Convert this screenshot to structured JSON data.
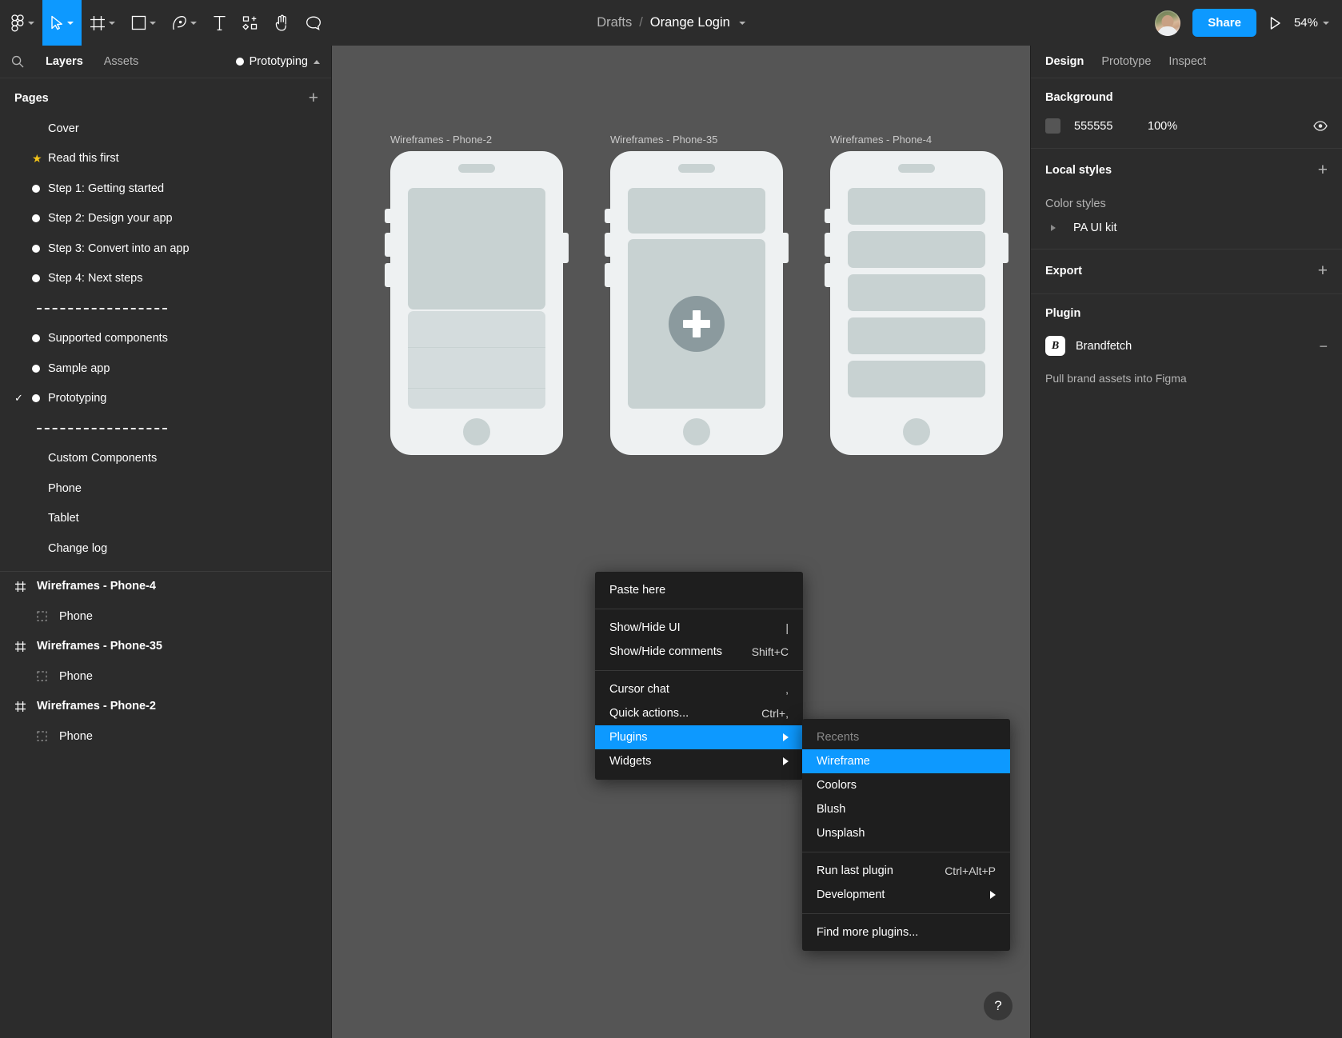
{
  "toolbar": {
    "menu_icon": "figma-logo-icon",
    "tools": [
      {
        "name": "figma-menu",
        "icon": "figma-logo-icon",
        "caret": true,
        "active": false
      },
      {
        "name": "move-tool",
        "icon": "cursor-icon",
        "caret": true,
        "active": true
      },
      {
        "name": "frame-tool",
        "icon": "frame-icon",
        "caret": true,
        "active": false
      },
      {
        "name": "shape-tool",
        "icon": "square-icon",
        "caret": true,
        "active": false
      },
      {
        "name": "pen-tool",
        "icon": "pen-icon",
        "caret": true,
        "active": false
      },
      {
        "name": "text-tool",
        "icon": "text-icon",
        "caret": false,
        "active": false
      },
      {
        "name": "resources-tool",
        "icon": "components-icon",
        "caret": false,
        "active": false
      },
      {
        "name": "hand-tool",
        "icon": "hand-icon",
        "caret": false,
        "active": false
      },
      {
        "name": "comment-tool",
        "icon": "comment-icon",
        "caret": false,
        "active": false
      }
    ],
    "breadcrumb": {
      "project": "Drafts",
      "separator": "/",
      "file": "Orange Login"
    },
    "share_label": "Share",
    "present_icon": "play-icon",
    "zoom_level": "54%",
    "avatar_name": "avatar"
  },
  "left_panel": {
    "search_icon": "search-icon",
    "tabs": [
      {
        "label": "Layers",
        "selected": true
      },
      {
        "label": "Assets",
        "selected": false
      }
    ],
    "prototyping_label": "Prototyping",
    "pages_header": "Pages",
    "add_page_label": "+",
    "pages": [
      {
        "label": "Cover",
        "glyph": "none",
        "checked": false
      },
      {
        "label": "Read this first",
        "glyph": "star",
        "checked": false
      },
      {
        "label": "Step 1: Getting started",
        "glyph": "dot",
        "checked": false
      },
      {
        "label": "Step 2: Design your app",
        "glyph": "dot",
        "checked": false
      },
      {
        "label": "Step 3: Convert into an app",
        "glyph": "dot",
        "checked": false
      },
      {
        "label": "Step 4: Next steps",
        "glyph": "dot",
        "checked": false
      },
      {
        "label": "",
        "glyph": "divider",
        "checked": false
      },
      {
        "label": "Supported components",
        "glyph": "dot",
        "checked": false
      },
      {
        "label": "Sample app",
        "glyph": "dot",
        "checked": false
      },
      {
        "label": "Prototyping",
        "glyph": "dot",
        "checked": true
      },
      {
        "label": "",
        "glyph": "divider",
        "checked": false
      },
      {
        "label": "Custom Components",
        "glyph": "none",
        "checked": false
      },
      {
        "label": "Phone",
        "glyph": "none",
        "checked": false
      },
      {
        "label": "Tablet",
        "glyph": "none",
        "checked": false
      },
      {
        "label": "Change log",
        "glyph": "none",
        "checked": false
      }
    ],
    "layers": [
      {
        "label": "Wireframes - Phone-4",
        "type": "frame"
      },
      {
        "label": "Phone",
        "type": "child"
      },
      {
        "label": "Wireframes - Phone-35",
        "type": "frame"
      },
      {
        "label": "Phone",
        "type": "child"
      },
      {
        "label": "Wireframes - Phone-2",
        "type": "frame"
      },
      {
        "label": "Phone",
        "type": "child"
      }
    ]
  },
  "canvas": {
    "frames": [
      {
        "label": "Wireframes - Phone-2",
        "variant": "phone2"
      },
      {
        "label": "Wireframes - Phone-35",
        "variant": "phone35"
      },
      {
        "label": "Wireframes - Phone-4",
        "variant": "phone4"
      }
    ]
  },
  "right_panel": {
    "tabs": [
      {
        "label": "Design",
        "selected": true
      },
      {
        "label": "Prototype",
        "selected": false
      },
      {
        "label": "Inspect",
        "selected": false
      }
    ],
    "background": {
      "title": "Background",
      "color_hex": "555555",
      "opacity": "100%",
      "visibility_icon": "eye-icon"
    },
    "local_styles": {
      "title": "Local styles",
      "add_label": "+",
      "color_styles_label": "Color styles",
      "style_name": "PA UI kit"
    },
    "export": {
      "title": "Export",
      "add_label": "+"
    },
    "plugin": {
      "title": "Plugin",
      "name": "Brandfetch",
      "icon_letter": "B",
      "collapse_label": "−",
      "description": "Pull brand assets into Figma"
    }
  },
  "context_menu": {
    "groups": [
      {
        "items": [
          {
            "label": "Paste here",
            "shortcut": "",
            "submenu": false,
            "highlighted": false
          }
        ]
      },
      {
        "items": [
          {
            "label": "Show/Hide UI",
            "shortcut": "|",
            "submenu": false,
            "highlighted": false
          },
          {
            "label": "Show/Hide comments",
            "shortcut": "Shift+C",
            "submenu": false,
            "highlighted": false
          }
        ]
      },
      {
        "items": [
          {
            "label": "Cursor chat",
            "shortcut": ",",
            "submenu": false,
            "highlighted": false
          },
          {
            "label": "Quick actions...",
            "shortcut": "Ctrl+,",
            "submenu": false,
            "highlighted": false
          },
          {
            "label": "Plugins",
            "shortcut": "",
            "submenu": true,
            "highlighted": true
          },
          {
            "label": "Widgets",
            "shortcut": "",
            "submenu": true,
            "highlighted": false
          }
        ]
      }
    ]
  },
  "plugins_submenu": {
    "groups": [
      {
        "items": [
          {
            "label": "Recents",
            "shortcut": "",
            "submenu": false,
            "highlighted": false,
            "header": true
          },
          {
            "label": "Wireframe",
            "shortcut": "",
            "submenu": false,
            "highlighted": true,
            "header": false
          },
          {
            "label": "Coolors",
            "shortcut": "",
            "submenu": false,
            "highlighted": false,
            "header": false
          },
          {
            "label": "Blush",
            "shortcut": "",
            "submenu": false,
            "highlighted": false,
            "header": false
          },
          {
            "label": "Unsplash",
            "shortcut": "",
            "submenu": false,
            "highlighted": false,
            "header": false
          }
        ]
      },
      {
        "items": [
          {
            "label": "Run last plugin",
            "shortcut": "Ctrl+Alt+P",
            "submenu": false,
            "highlighted": false,
            "header": false
          },
          {
            "label": "Development",
            "shortcut": "",
            "submenu": true,
            "highlighted": false,
            "header": false
          }
        ]
      },
      {
        "items": [
          {
            "label": "Find more plugins...",
            "shortcut": "",
            "submenu": false,
            "highlighted": false,
            "header": false
          }
        ]
      }
    ]
  },
  "help_button": {
    "label": "?"
  },
  "colors": {
    "accent": "#0d99ff",
    "panel_bg": "#2c2c2c",
    "canvas_bg": "#555555",
    "menu_bg": "#1e1e1e",
    "star": "#f5c518"
  }
}
